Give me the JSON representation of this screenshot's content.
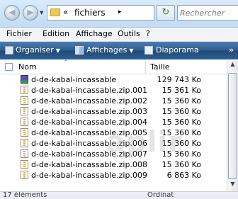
{
  "address": {
    "separator": "«",
    "crumb": "fichiers",
    "crumb_arrow": "▸"
  },
  "nav": {
    "back_glyph": "◀",
    "forward_glyph": "▶",
    "dropdown_glyph": "▼",
    "refresh_glyph": "↻"
  },
  "search": {
    "placeholder": "Rechercher"
  },
  "menu": {
    "file": "Fichier",
    "edit": "Edition",
    "view": "Affichage",
    "tools": "Outils",
    "help": "?"
  },
  "toolbar": {
    "organize": "Organiser",
    "views": "Affichages",
    "slideshow": "Diaporama",
    "more": "»",
    "caret": "▼"
  },
  "columns": {
    "name": "Nom",
    "size": "Taille",
    "sort_glyph": "^"
  },
  "files": [
    {
      "name": "d-de-kabal-incassable",
      "size": "129 743 Ko",
      "type": "rar"
    },
    {
      "name": "d-de-kabal-incassable.zip.001",
      "size": "15 361 Ko",
      "type": "zip"
    },
    {
      "name": "d-de-kabal-incassable.zip.002",
      "size": "15 360 Ko",
      "type": "zip"
    },
    {
      "name": "d-de-kabal-incassable.zip.003",
      "size": "15 360 Ko",
      "type": "zip"
    },
    {
      "name": "d-de-kabal-incassable.zip.004",
      "size": "15 360 Ko",
      "type": "zip"
    },
    {
      "name": "d-de-kabal-incassable.zip.005",
      "size": "15 360 Ko",
      "type": "zip"
    },
    {
      "name": "d-de-kabal-incassable.zip.006",
      "size": "15 360 Ko",
      "type": "zip"
    },
    {
      "name": "d-de-kabal-incassable.zip.007",
      "size": "15 360 Ko",
      "type": "zip"
    },
    {
      "name": "d-de-kabal-incassable.zip.008",
      "size": "15 360 Ko",
      "type": "zip"
    },
    {
      "name": "d-de-kabal-incassable.zip.009",
      "size": "6 863 Ko",
      "type": "zip"
    }
  ],
  "watermark": "aplir",
  "scroll": {
    "up": "▲",
    "down": "▼"
  },
  "status": {
    "left": "17 éléments",
    "right": "Ordinat"
  },
  "colors": {
    "toolbar": "#2b5a8c",
    "address_bg": "#c3dcf3"
  }
}
